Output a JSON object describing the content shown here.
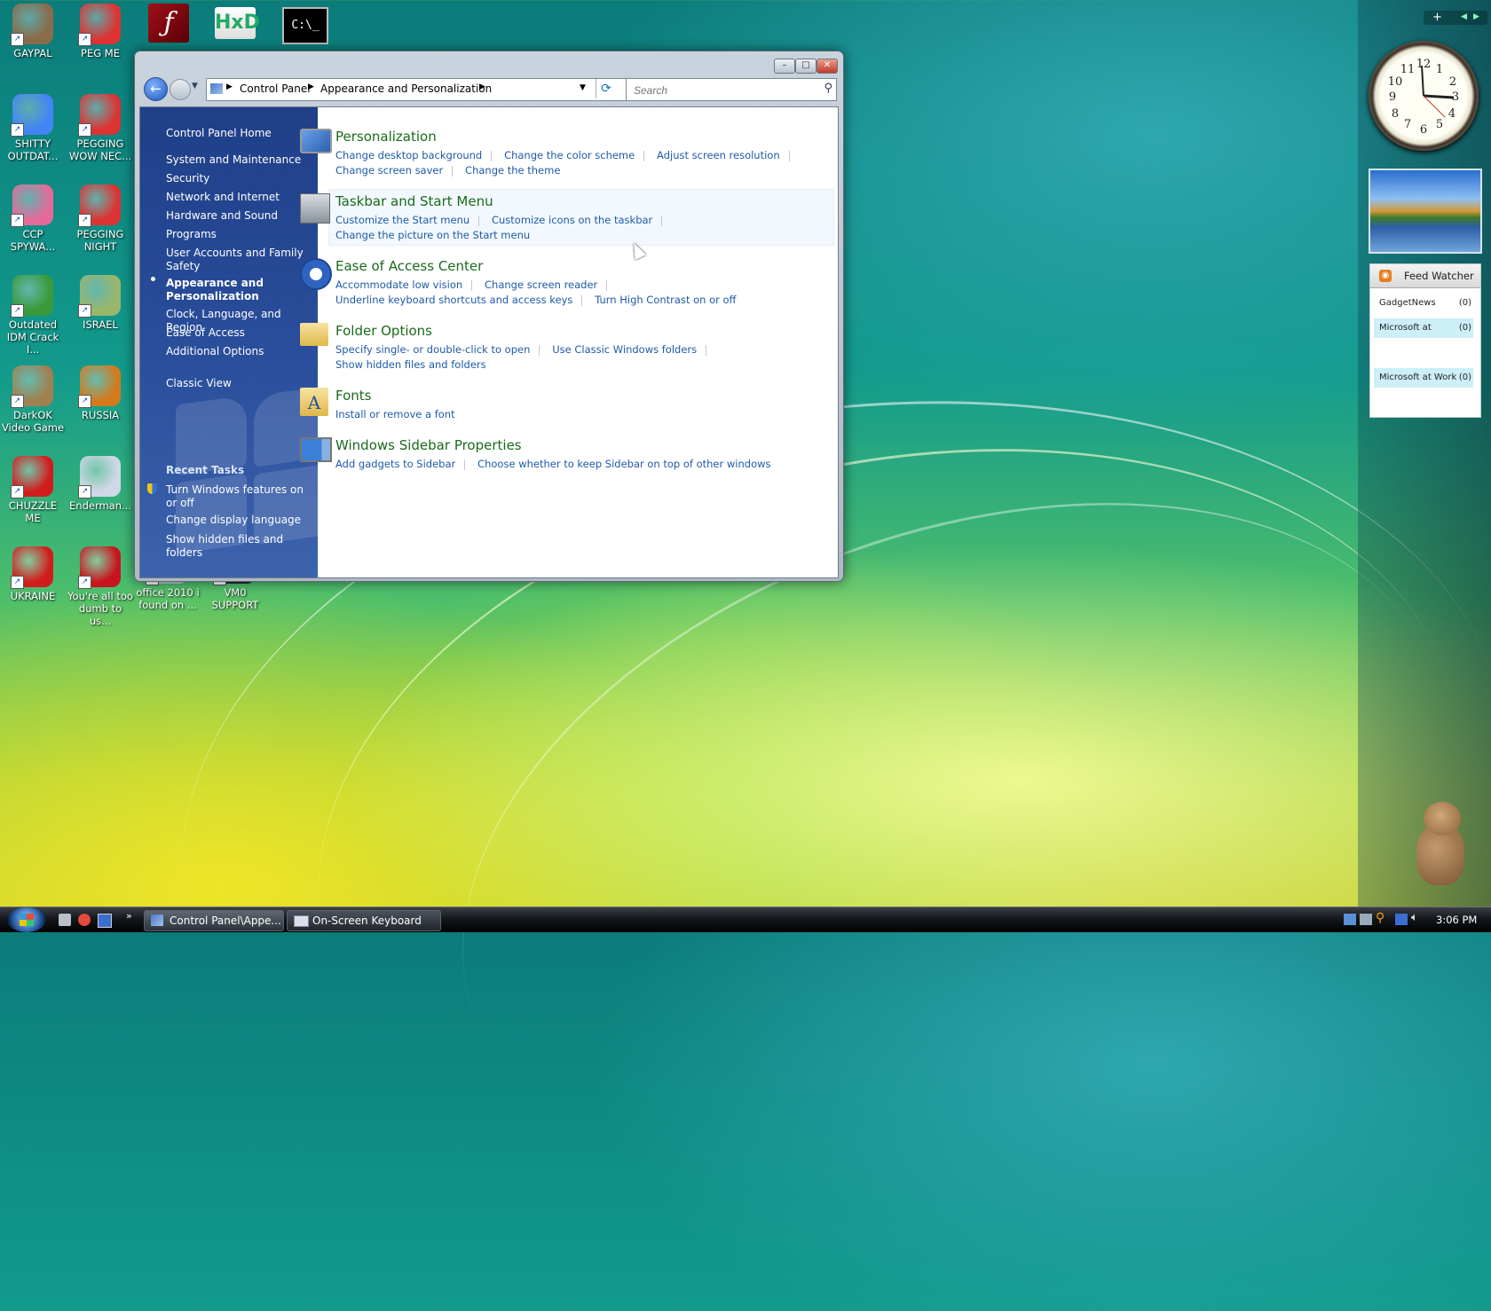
{
  "desktop_icons": [
    {
      "label": "GAYPAL",
      "color": "#8a6b4a"
    },
    {
      "label": "PEG ME",
      "color": "#d33"
    },
    {
      "label": "SHITTY OUTDAT...",
      "color": "#4285f4"
    },
    {
      "label": "PEGGING WOW NEC...",
      "color": "#d33"
    },
    {
      "label": "CCP SPYWA...",
      "color": "#e56a9a"
    },
    {
      "label": "PEGGING NIGHT",
      "color": "#d33"
    },
    {
      "label": "Outdated IDM Crack I...",
      "color": "#3a9a3a"
    },
    {
      "label": "ISRAEL",
      "color": "#9ab66b"
    },
    {
      "label": "DarkOK Video Game",
      "color": "#a08050"
    },
    {
      "label": "RUSSIA",
      "color": "#d47a1c"
    },
    {
      "label": "CHUZZLE ME",
      "color": "#d21c1c"
    },
    {
      "label": "Enderman...",
      "color": "#cfd8e6"
    },
    {
      "label": "UKRAINE",
      "color": "#d21c1c"
    },
    {
      "label": "You're all too dumb to us...",
      "color": "#c8141e"
    },
    {
      "label": "office 2010 i found on ...",
      "color": "#c0c8d6"
    },
    {
      "label": "VM0 SUPPORT",
      "color": "#2a2a2a"
    }
  ],
  "address_bar": {
    "items": [
      "Control Panel",
      "Appearance and Personalization"
    ]
  },
  "search": {
    "placeholder": "Search"
  },
  "left_pane": {
    "home": "Control Panel Home",
    "items": [
      "System and Maintenance",
      "Security",
      "Network and Internet",
      "Hardware and Sound",
      "Programs",
      "User Accounts and Family Safety",
      "Appearance and Personalization",
      "Clock, Language, and Region",
      "Ease of Access",
      "Additional Options"
    ],
    "classic_view": "Classic View",
    "recent_tasks_title": "Recent Tasks",
    "recent_tasks": [
      "Turn Windows features on or off",
      "Change display language",
      "Show hidden files and folders"
    ]
  },
  "categories": [
    {
      "title": "Personalization",
      "links": [
        "Change desktop background",
        "Change the color scheme",
        "Adjust screen resolution",
        "Change screen saver",
        "Change the theme"
      ]
    },
    {
      "title": "Taskbar and Start Menu",
      "links": [
        "Customize the Start menu",
        "Customize icons on the taskbar",
        "Change the picture on the Start menu"
      ]
    },
    {
      "title": "Ease of Access Center",
      "links": [
        "Accommodate low vision",
        "Change screen reader",
        "Underline keyboard shortcuts and access keys",
        "Turn High Contrast on or off"
      ]
    },
    {
      "title": "Folder Options",
      "links": [
        "Specify single- or double-click to open",
        "Use Classic Windows folders",
        "Show hidden files and folders"
      ]
    },
    {
      "title": "Fonts",
      "links": [
        "Install or remove a font"
      ]
    },
    {
      "title": "Windows Sidebar Properties",
      "links": [
        "Add gadgets to Sidebar",
        "Choose whether to keep Sidebar on top of other windows"
      ]
    }
  ],
  "sidebar": {
    "feed_watcher": {
      "title": "Feed Watcher",
      "feeds": [
        {
          "name": "GadgetNews",
          "count": "(0)"
        },
        {
          "name": "Microsoft at",
          "count": "(0)"
        },
        {
          "name": "Microsoft at Work",
          "count": "(0)"
        }
      ]
    }
  },
  "taskbar": {
    "items": [
      "Control Panel\\Appe...",
      "On-Screen Keyboard"
    ],
    "clock": "3:06 PM"
  }
}
